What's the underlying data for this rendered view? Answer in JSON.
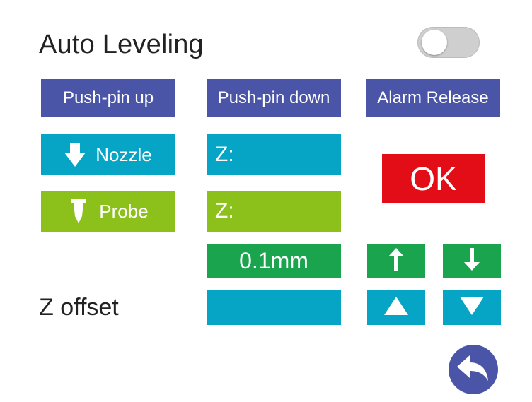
{
  "header": {
    "title": "Auto Leveling",
    "toggle_state": "off"
  },
  "buttons": {
    "push_pin_up": "Push-pin up",
    "push_pin_down": "Push-pin down",
    "alarm_release": "Alarm Release",
    "nozzle": "Nozzle",
    "probe": "Probe",
    "ok": "OK"
  },
  "fields": {
    "nozzle_z_label": "Z:",
    "probe_z_label": "Z:",
    "step_value": "0.1mm",
    "z_offset_label": "Z offset",
    "z_offset_value": ""
  },
  "icons": {
    "nozzle": "nozzle-down-icon",
    "probe": "probe-icon",
    "move_up": "arrow-up-icon",
    "move_down": "arrow-down-icon",
    "offset_up": "triangle-up-icon",
    "offset_down": "triangle-down-icon",
    "back": "back-arrow-icon"
  },
  "colors": {
    "purple": "#4b55a8",
    "cyan": "#06a5c6",
    "lime": "#8cc11c",
    "green": "#1aa44e",
    "red": "#e30d18"
  }
}
